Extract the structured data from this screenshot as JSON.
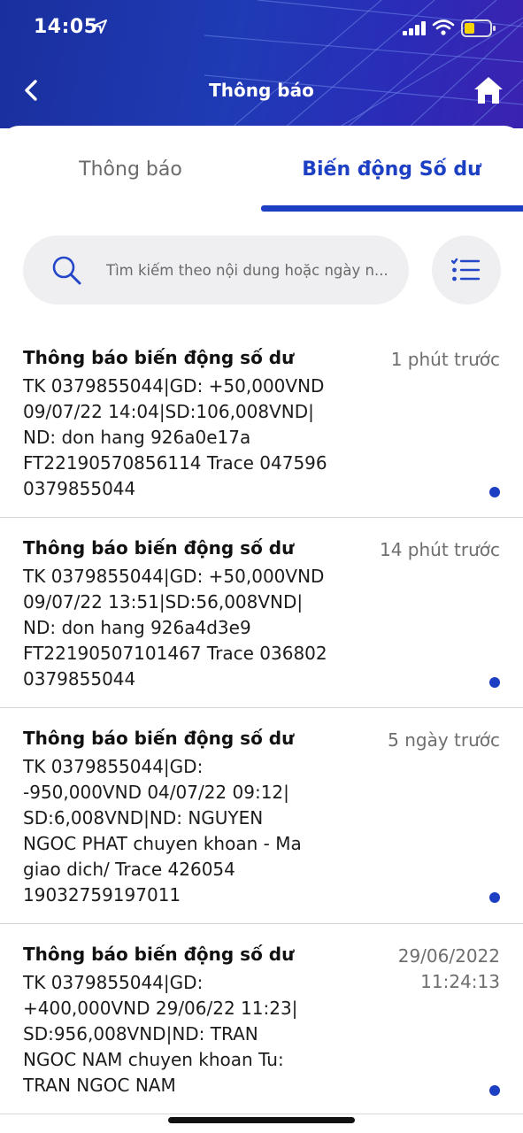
{
  "status_bar": {
    "time": "14:05",
    "icons": [
      "location-arrow-icon",
      "signal-bars-icon",
      "wifi-icon",
      "battery-icon"
    ]
  },
  "nav": {
    "title": "Thông báo",
    "back_icon": "chevron-left-icon",
    "home_icon": "home-icon"
  },
  "tabs": [
    {
      "label": "Thông báo",
      "active": false
    },
    {
      "label": "Biến động Số dư",
      "active": true
    }
  ],
  "search": {
    "placeholder": "Tìm kiếm theo nội dung hoặc ngày n...",
    "icon": "search-icon",
    "filter_icon": "filter-list-icon"
  },
  "colors": {
    "accent": "#1d3fc4",
    "header_gradient_start": "#1a2f9e",
    "header_gradient_end": "#3b22b0"
  },
  "notifications": [
    {
      "title": "Thông báo biến động số dư",
      "time": "1 phút trước",
      "body": "TK 0379855044|GD: +50,000VND\n09/07/22 14:04|SD:106,008VND|\nND: don hang 926a0e17a\nFT22190570856114 Trace 047596\n0379855044",
      "unread": true
    },
    {
      "title": "Thông báo biến động số dư",
      "time": "14 phút trước",
      "body": "TK 0379855044|GD: +50,000VND\n09/07/22 13:51|SD:56,008VND|\nND: don hang 926a4d3e9\nFT22190507101467 Trace 036802\n0379855044",
      "unread": true
    },
    {
      "title": "Thông báo biến động số dư",
      "time": "5 ngày trước",
      "body": "TK 0379855044|GD:\n-950,000VND 04/07/22 09:12|\nSD:6,008VND|ND: NGUYEN\nNGOC PHAT chuyen khoan - Ma\ngiao dich/ Trace 426054\n19032759197011",
      "unread": true
    },
    {
      "title": "Thông báo biến động số dư",
      "time": "29/06/2022\n11:24:13",
      "body": "TK 0379855044|GD:\n+400,000VND 29/06/22 11:23|\nSD:956,008VND|ND: TRAN\nNGOC NAM chuyen khoan Tu:\nTRAN NGOC NAM",
      "unread": true
    }
  ]
}
